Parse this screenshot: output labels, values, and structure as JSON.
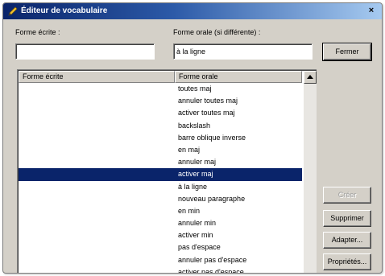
{
  "window": {
    "title": "Éditeur de vocabulaire",
    "close_glyph": "×"
  },
  "form": {
    "written_label": "Forme écrite :",
    "written_value": "",
    "spoken_label": "Forme orale (si différente) :",
    "spoken_value": "à la ligne"
  },
  "buttons": {
    "close": "Fermer",
    "create": "Créer",
    "delete": "Supprimer",
    "adapt": "Adapter...",
    "properties": "Propriétés..."
  },
  "list": {
    "col_written": "Forme écrite",
    "col_spoken": "Forme orale",
    "selected_index": 7,
    "rows": [
      {
        "written": "",
        "spoken": "toutes maj"
      },
      {
        "written": "",
        "spoken": "annuler toutes maj"
      },
      {
        "written": "",
        "spoken": "activer toutes maj"
      },
      {
        "written": "",
        "spoken": "backslash"
      },
      {
        "written": "",
        "spoken": "barre oblique inverse"
      },
      {
        "written": "",
        "spoken": "en maj"
      },
      {
        "written": "",
        "spoken": "annuler maj"
      },
      {
        "written": "",
        "spoken": "activer maj"
      },
      {
        "written": "",
        "spoken": "à la ligne"
      },
      {
        "written": "",
        "spoken": "nouveau paragraphe"
      },
      {
        "written": "",
        "spoken": "en min"
      },
      {
        "written": "",
        "spoken": "annuler min"
      },
      {
        "written": "",
        "spoken": "activer min"
      },
      {
        "written": "",
        "spoken": "pas d'espace"
      },
      {
        "written": "",
        "spoken": "annuler pas d'espace"
      },
      {
        "written": "",
        "spoken": "activer pas d'espace"
      }
    ]
  },
  "icons": {
    "title": "pencil-icon",
    "scroll_up": "scroll-up-arrow-icon"
  },
  "colors": {
    "titlebar_start": "#0a246a",
    "titlebar_end": "#a6caf0",
    "selection": "#0a246a",
    "dialog_face": "#d4d0c8"
  }
}
